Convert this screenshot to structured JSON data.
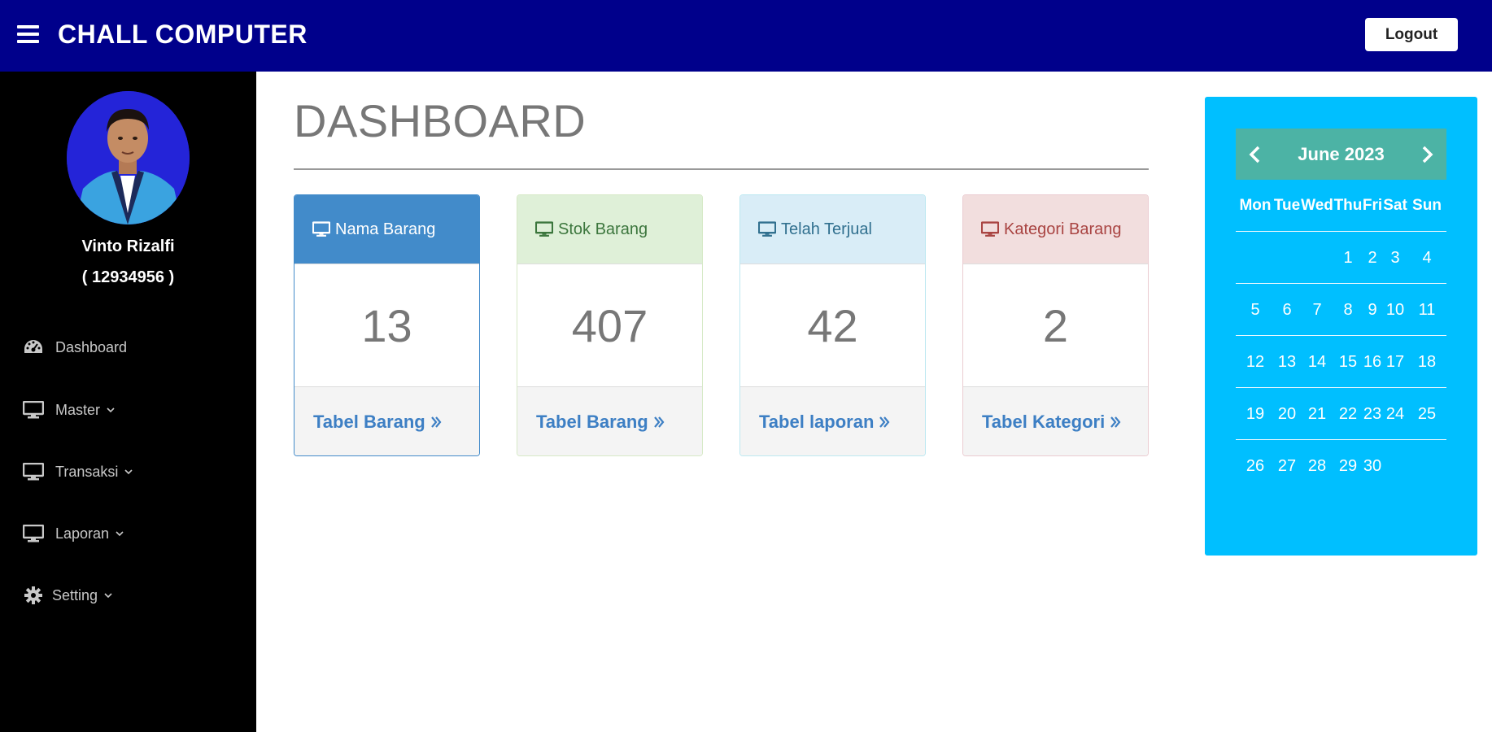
{
  "header": {
    "brand": "CHALL COMPUTER",
    "logout_label": "Logout"
  },
  "user": {
    "name": "Vinto Rizalfi",
    "id": "( 12934956 )"
  },
  "sidebar": {
    "items": [
      {
        "label": "Dashboard",
        "icon": "tachometer-icon"
      },
      {
        "label": "Master",
        "icon": "monitor-icon"
      },
      {
        "label": "Transaksi",
        "icon": "monitor-icon"
      },
      {
        "label": "Laporan",
        "icon": "monitor-icon"
      },
      {
        "label": "Setting",
        "icon": "gear-icon"
      }
    ]
  },
  "main": {
    "title": "DASHBOARD",
    "cards": [
      {
        "title": "Nama Barang",
        "value": "13",
        "link": "Tabel Barang",
        "head_bg": "#428bca",
        "head_color": "#ffffff",
        "border": "#428bca"
      },
      {
        "title": "Stok Barang",
        "value": "407",
        "link": "Tabel Barang",
        "head_bg": "#dff0d8",
        "head_color": "#3c763d",
        "border": "#d6e9c6"
      },
      {
        "title": "Telah Terjual",
        "value": "42",
        "link": "Tabel laporan",
        "head_bg": "#d9edf7",
        "head_color": "#31708f",
        "border": "#bce8f1"
      },
      {
        "title": "Kategori Barang",
        "value": "2",
        "link": "Tabel Kategori",
        "head_bg": "#f2dede",
        "head_color": "#a94442",
        "border": "#ebccd1"
      }
    ]
  },
  "calendar": {
    "month": "June 2023",
    "days_of_week": [
      "Mon",
      "Tue",
      "Wed",
      "Thu",
      "Fri",
      "Sat",
      "Sun"
    ],
    "weeks": [
      [
        "",
        "",
        "",
        "1",
        "2",
        "3",
        "4"
      ],
      [
        "5",
        "6",
        "7",
        "8",
        "9",
        "10",
        "11"
      ],
      [
        "12",
        "13",
        "14",
        "15",
        "16",
        "17",
        "18"
      ],
      [
        "19",
        "20",
        "21",
        "22",
        "23",
        "24",
        "25"
      ],
      [
        "26",
        "27",
        "28",
        "29",
        "30",
        "",
        ""
      ]
    ]
  },
  "colors": {
    "navbar": "#00008b",
    "sidebar": "#000000",
    "calendar_bg": "#00bfff",
    "calendar_header": "#4cb3a5",
    "link": "#3d7fc4"
  }
}
